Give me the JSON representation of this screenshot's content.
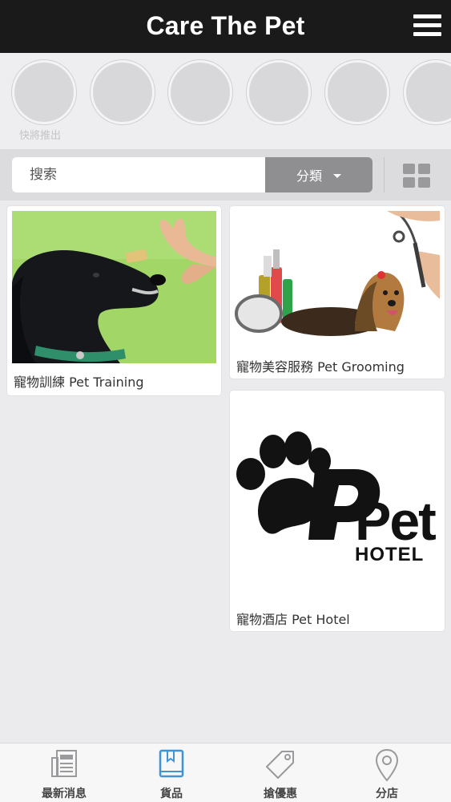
{
  "header": {
    "title": "Care The Pet"
  },
  "stories": {
    "first_label": "快將推出"
  },
  "search": {
    "placeholder": "搜索",
    "category_label": "分類"
  },
  "products": [
    {
      "name": "寵物訓練 Pet Training"
    },
    {
      "name": "寵物美容服務 Pet Grooming"
    },
    {
      "name": "寵物酒店 Pet Hotel"
    }
  ],
  "hotel_logo": {
    "big_text": "Pet",
    "small_text": "HOTEL"
  },
  "tabs": [
    {
      "label": "最新消息",
      "icon": "newspaper-icon",
      "active": false
    },
    {
      "label": "貨品",
      "icon": "book-icon",
      "active": true
    },
    {
      "label": "搶優惠",
      "icon": "tag-icon",
      "active": false
    },
    {
      "label": "分店",
      "icon": "location-pin-icon",
      "active": false
    }
  ],
  "colors": {
    "header_bg": "#1b1a1a",
    "active_tab": "#3d95d5",
    "inactive_tab": "#9a9a9d"
  }
}
